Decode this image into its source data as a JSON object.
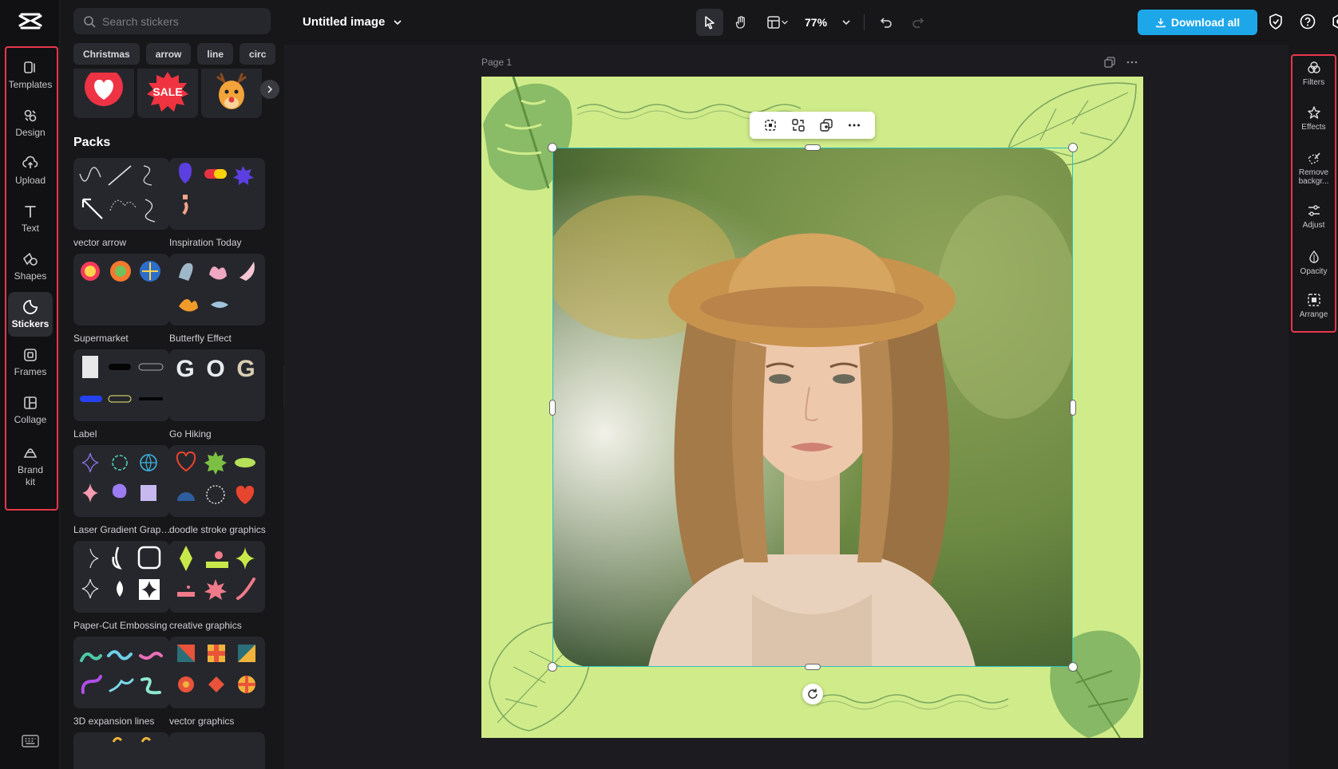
{
  "rail": {
    "items": [
      {
        "label": "Templates",
        "icon": "templates-icon"
      },
      {
        "label": "Design",
        "icon": "design-icon"
      },
      {
        "label": "Upload",
        "icon": "upload-icon"
      },
      {
        "label": "Text",
        "icon": "text-icon"
      },
      {
        "label": "Shapes",
        "icon": "shapes-icon"
      },
      {
        "label": "Stickers",
        "icon": "stickers-icon",
        "active": true
      },
      {
        "label": "Frames",
        "icon": "frames-icon"
      },
      {
        "label": "Collage",
        "icon": "collage-icon"
      },
      {
        "label": "Brand kit",
        "icon": "brand-kit-icon"
      }
    ]
  },
  "panel": {
    "search_placeholder": "Search stickers",
    "chips": [
      "Christmas",
      "arrow",
      "line",
      "circ"
    ],
    "packs_title": "Packs",
    "packs": [
      {
        "name": "vector arrow"
      },
      {
        "name": "Inspiration Today"
      },
      {
        "name": "Supermarket"
      },
      {
        "name": "Butterfly Effect"
      },
      {
        "name": "Label"
      },
      {
        "name": "Go Hiking"
      },
      {
        "name": "Laser Gradient Graph..."
      },
      {
        "name": "doodle stroke graphics"
      },
      {
        "name": "Paper-Cut Embossing"
      },
      {
        "name": "creative graphics"
      },
      {
        "name": "3D expansion lines"
      },
      {
        "name": "vector graphics"
      }
    ]
  },
  "topbar": {
    "title": "Untitled image",
    "zoom": "77%",
    "download_label": "Download all"
  },
  "canvas": {
    "page_label": "Page 1"
  },
  "right_panel": {
    "items": [
      {
        "label": "Filters",
        "icon": "filters-icon"
      },
      {
        "label": "Effects",
        "icon": "effects-icon"
      },
      {
        "label": "Remove backgr...",
        "icon": "remove-background-icon"
      },
      {
        "label": "Adjust",
        "icon": "adjust-icon"
      },
      {
        "label": "Opacity",
        "icon": "opacity-icon"
      },
      {
        "label": "Arrange",
        "icon": "arrange-icon"
      }
    ]
  },
  "colors": {
    "accent": "#1ea7e8",
    "highlight_border": "#e8374a",
    "selection": "#2bc2c2",
    "artboard_bg": "#d0ec8a"
  }
}
